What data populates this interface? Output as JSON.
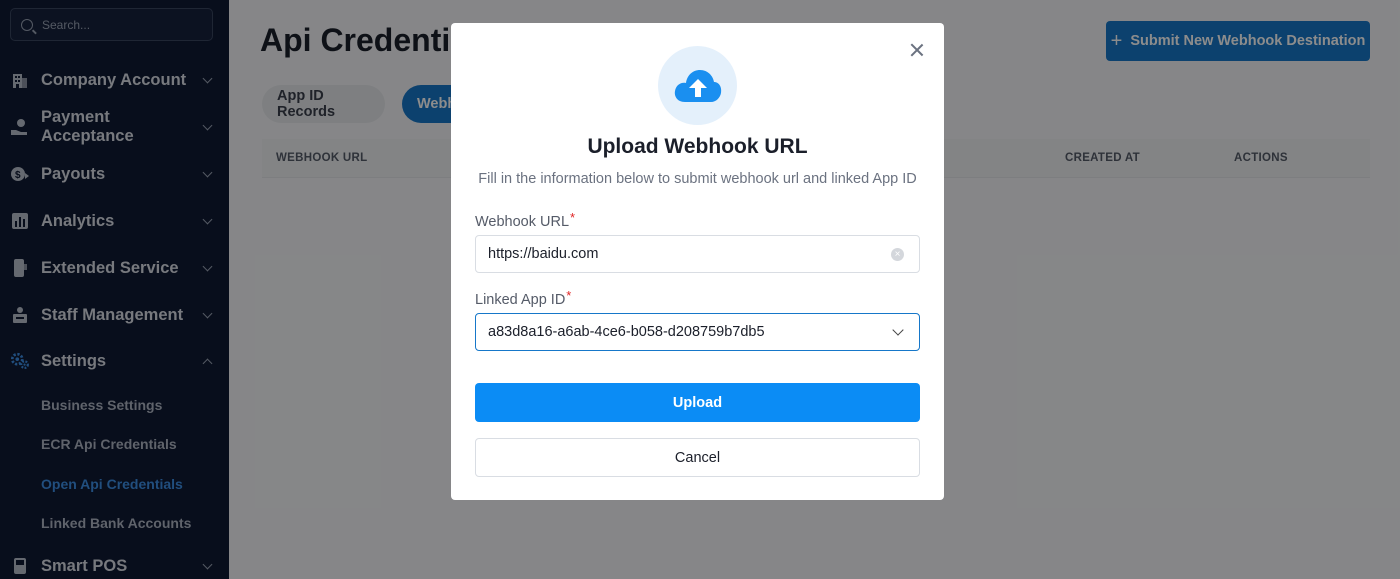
{
  "sidebar": {
    "search_placeholder": "Search...",
    "items": [
      {
        "label": "Company Account",
        "icon": "building-icon"
      },
      {
        "label": "Payment Acceptance",
        "icon": "hand-coin-icon"
      },
      {
        "label": "Payouts",
        "icon": "money-out-icon"
      },
      {
        "label": "Analytics",
        "icon": "chart-icon"
      },
      {
        "label": "Extended Service",
        "icon": "phone-icon"
      },
      {
        "label": "Staff Management",
        "icon": "staff-icon"
      },
      {
        "label": "Settings",
        "icon": "gears-icon"
      },
      {
        "label": "Smart POS",
        "icon": "pos-icon"
      }
    ],
    "settings_sub": [
      {
        "label": "Business Settings"
      },
      {
        "label": "ECR Api Credentials"
      },
      {
        "label": "Open Api Credentials"
      },
      {
        "label": "Linked Bank Accounts"
      }
    ]
  },
  "main": {
    "title": "Api Credentials",
    "submit_button": "Submit New Webhook Destination",
    "tabs": [
      "App ID Records",
      "Webhook"
    ],
    "columns": [
      "WEBHOOK URL",
      "CREATED AT",
      "ACTIONS"
    ]
  },
  "modal": {
    "title": "Upload Webhook URL",
    "subtitle": "Fill in the information below to submit webhook url and linked App ID",
    "webhook_label": "Webhook URL",
    "webhook_value": "https://baidu.com",
    "app_id_label": "Linked App ID",
    "app_id_value": "a83d8a16-a6ab-4ce6-b058-d208759b7db5",
    "required_mark": "*",
    "upload_button": "Upload",
    "cancel_button": "Cancel"
  },
  "colors": {
    "sidebar_bg": "#0f1a33",
    "accent": "#1677c9",
    "upload_button": "#0b8cf5",
    "active_sub_item": "#3c8fe6"
  }
}
